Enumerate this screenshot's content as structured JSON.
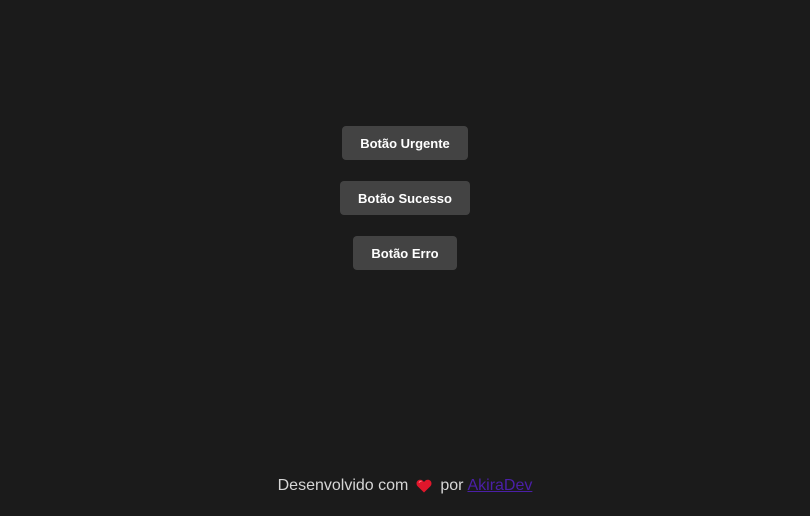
{
  "buttons": {
    "urgent_label": "Botão Urgente",
    "success_label": "Botão Sucesso",
    "error_label": "Botão Erro"
  },
  "footer": {
    "prefix": "Desenvolvido com",
    "heart_icon": "heart-icon",
    "by": "por",
    "link_text": "AkiraDev"
  },
  "colors": {
    "background": "#1b1b1b",
    "button_bg": "#434343",
    "button_text": "#ffffff",
    "heart": "#e0162b",
    "link": "#4b1fa8"
  }
}
